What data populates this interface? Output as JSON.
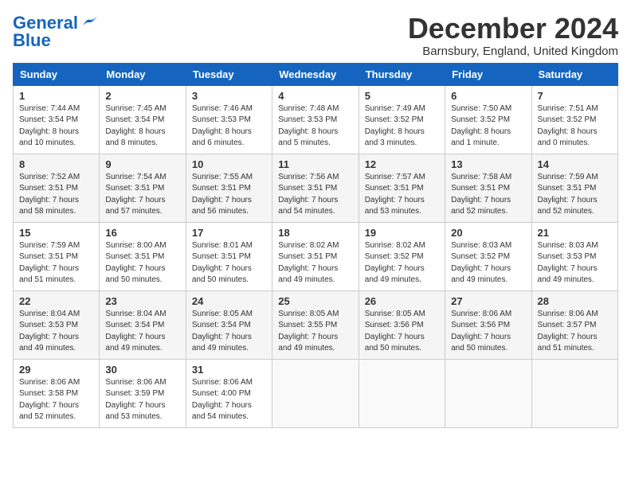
{
  "logo": {
    "line1": "General",
    "line2": "Blue"
  },
  "header": {
    "month": "December 2024",
    "location": "Barnsbury, England, United Kingdom"
  },
  "days_of_week": [
    "Sunday",
    "Monday",
    "Tuesday",
    "Wednesday",
    "Thursday",
    "Friday",
    "Saturday"
  ],
  "weeks": [
    [
      {
        "day": "1",
        "info": "Sunrise: 7:44 AM\nSunset: 3:54 PM\nDaylight: 8 hours\nand 10 minutes."
      },
      {
        "day": "2",
        "info": "Sunrise: 7:45 AM\nSunset: 3:54 PM\nDaylight: 8 hours\nand 8 minutes."
      },
      {
        "day": "3",
        "info": "Sunrise: 7:46 AM\nSunset: 3:53 PM\nDaylight: 8 hours\nand 6 minutes."
      },
      {
        "day": "4",
        "info": "Sunrise: 7:48 AM\nSunset: 3:53 PM\nDaylight: 8 hours\nand 5 minutes."
      },
      {
        "day": "5",
        "info": "Sunrise: 7:49 AM\nSunset: 3:52 PM\nDaylight: 8 hours\nand 3 minutes."
      },
      {
        "day": "6",
        "info": "Sunrise: 7:50 AM\nSunset: 3:52 PM\nDaylight: 8 hours\nand 1 minute."
      },
      {
        "day": "7",
        "info": "Sunrise: 7:51 AM\nSunset: 3:52 PM\nDaylight: 8 hours\nand 0 minutes."
      }
    ],
    [
      {
        "day": "8",
        "info": "Sunrise: 7:52 AM\nSunset: 3:51 PM\nDaylight: 7 hours\nand 58 minutes."
      },
      {
        "day": "9",
        "info": "Sunrise: 7:54 AM\nSunset: 3:51 PM\nDaylight: 7 hours\nand 57 minutes."
      },
      {
        "day": "10",
        "info": "Sunrise: 7:55 AM\nSunset: 3:51 PM\nDaylight: 7 hours\nand 56 minutes."
      },
      {
        "day": "11",
        "info": "Sunrise: 7:56 AM\nSunset: 3:51 PM\nDaylight: 7 hours\nand 54 minutes."
      },
      {
        "day": "12",
        "info": "Sunrise: 7:57 AM\nSunset: 3:51 PM\nDaylight: 7 hours\nand 53 minutes."
      },
      {
        "day": "13",
        "info": "Sunrise: 7:58 AM\nSunset: 3:51 PM\nDaylight: 7 hours\nand 52 minutes."
      },
      {
        "day": "14",
        "info": "Sunrise: 7:59 AM\nSunset: 3:51 PM\nDaylight: 7 hours\nand 52 minutes."
      }
    ],
    [
      {
        "day": "15",
        "info": "Sunrise: 7:59 AM\nSunset: 3:51 PM\nDaylight: 7 hours\nand 51 minutes."
      },
      {
        "day": "16",
        "info": "Sunrise: 8:00 AM\nSunset: 3:51 PM\nDaylight: 7 hours\nand 50 minutes."
      },
      {
        "day": "17",
        "info": "Sunrise: 8:01 AM\nSunset: 3:51 PM\nDaylight: 7 hours\nand 50 minutes."
      },
      {
        "day": "18",
        "info": "Sunrise: 8:02 AM\nSunset: 3:51 PM\nDaylight: 7 hours\nand 49 minutes."
      },
      {
        "day": "19",
        "info": "Sunrise: 8:02 AM\nSunset: 3:52 PM\nDaylight: 7 hours\nand 49 minutes."
      },
      {
        "day": "20",
        "info": "Sunrise: 8:03 AM\nSunset: 3:52 PM\nDaylight: 7 hours\nand 49 minutes."
      },
      {
        "day": "21",
        "info": "Sunrise: 8:03 AM\nSunset: 3:53 PM\nDaylight: 7 hours\nand 49 minutes."
      }
    ],
    [
      {
        "day": "22",
        "info": "Sunrise: 8:04 AM\nSunset: 3:53 PM\nDaylight: 7 hours\nand 49 minutes."
      },
      {
        "day": "23",
        "info": "Sunrise: 8:04 AM\nSunset: 3:54 PM\nDaylight: 7 hours\nand 49 minutes."
      },
      {
        "day": "24",
        "info": "Sunrise: 8:05 AM\nSunset: 3:54 PM\nDaylight: 7 hours\nand 49 minutes."
      },
      {
        "day": "25",
        "info": "Sunrise: 8:05 AM\nSunset: 3:55 PM\nDaylight: 7 hours\nand 49 minutes."
      },
      {
        "day": "26",
        "info": "Sunrise: 8:05 AM\nSunset: 3:56 PM\nDaylight: 7 hours\nand 50 minutes."
      },
      {
        "day": "27",
        "info": "Sunrise: 8:06 AM\nSunset: 3:56 PM\nDaylight: 7 hours\nand 50 minutes."
      },
      {
        "day": "28",
        "info": "Sunrise: 8:06 AM\nSunset: 3:57 PM\nDaylight: 7 hours\nand 51 minutes."
      }
    ],
    [
      {
        "day": "29",
        "info": "Sunrise: 8:06 AM\nSunset: 3:58 PM\nDaylight: 7 hours\nand 52 minutes."
      },
      {
        "day": "30",
        "info": "Sunrise: 8:06 AM\nSunset: 3:59 PM\nDaylight: 7 hours\nand 53 minutes."
      },
      {
        "day": "31",
        "info": "Sunrise: 8:06 AM\nSunset: 4:00 PM\nDaylight: 7 hours\nand 54 minutes."
      },
      {
        "day": "",
        "info": ""
      },
      {
        "day": "",
        "info": ""
      },
      {
        "day": "",
        "info": ""
      },
      {
        "day": "",
        "info": ""
      }
    ]
  ]
}
